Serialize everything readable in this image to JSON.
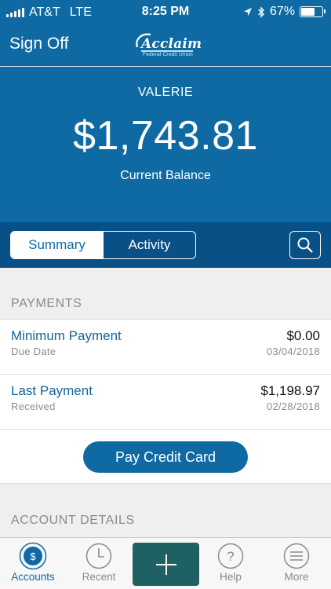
{
  "status_bar": {
    "carrier": "AT&T",
    "network": "LTE",
    "time": "8:25 PM",
    "battery": "67%",
    "battery_level": 0.67,
    "icons": [
      "signal-icon",
      "location-arrow-icon",
      "bluetooth-icon",
      "battery-icon"
    ]
  },
  "header": {
    "sign_off_label": "Sign Off",
    "logo_name": "Acclaim",
    "logo_subtitle": "Federal Credit Union"
  },
  "account": {
    "member_name": "VALERIE",
    "balance": "$1,743.81",
    "balance_label": "Current Balance"
  },
  "tabs": {
    "items": [
      {
        "label": "Summary",
        "active": true
      },
      {
        "label": "Activity",
        "active": false
      }
    ],
    "search_icon": "search-icon"
  },
  "payments": {
    "header": "PAYMENTS",
    "rows": [
      {
        "title": "Minimum Payment",
        "subtitle": "Due Date",
        "amount": "$0.00",
        "date": "03/04/2018"
      },
      {
        "title": "Last Payment",
        "subtitle": "Received",
        "amount": "$1,198.97",
        "date": "02/28/2018"
      }
    ],
    "pay_button_label": "Pay Credit Card"
  },
  "account_details": {
    "header": "ACCOUNT DETAILS"
  },
  "tab_bar": {
    "items": [
      {
        "label": "Accounts",
        "icon": "dollar-circle-icon",
        "active": true
      },
      {
        "label": "Recent",
        "icon": "clock-icon",
        "active": false
      },
      {
        "label": "",
        "icon": "plus-icon",
        "active": false
      },
      {
        "label": "Help",
        "icon": "question-icon",
        "active": false
      },
      {
        "label": "More",
        "icon": "menu-icon",
        "active": false
      }
    ]
  },
  "colors": {
    "brand_blue": "#0f6aa3",
    "tab_band": "#085086",
    "center_button": "#1e6163"
  }
}
